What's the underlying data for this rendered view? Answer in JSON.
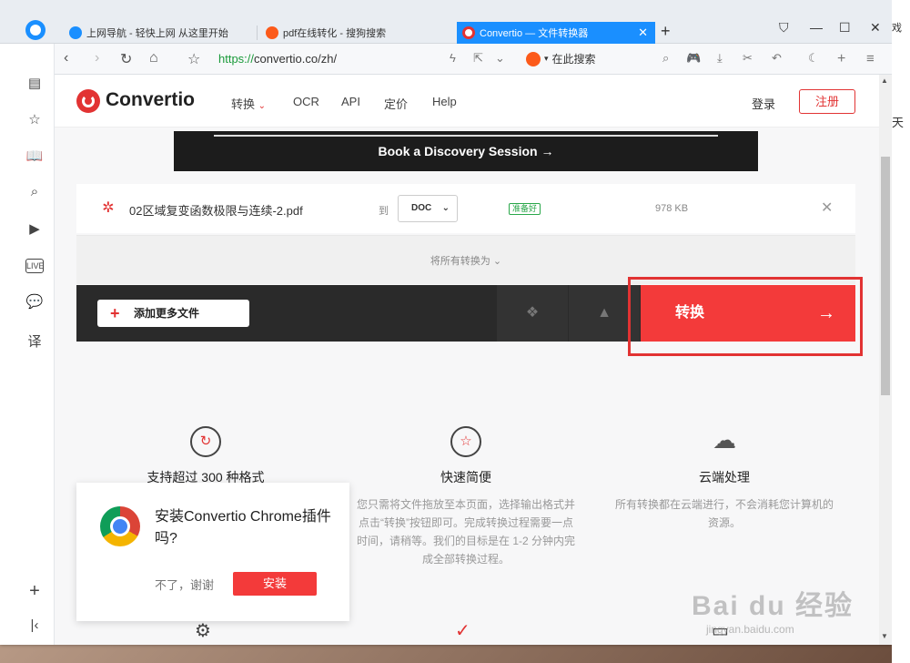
{
  "browser": {
    "tabs": [
      {
        "label": "上网导航 - 轻快上网 从这里开始",
        "favicon_color": "#1a8fff"
      },
      {
        "label": "pdf在线转化 - 搜狗搜索",
        "favicon_color": "#fc5a1a"
      },
      {
        "label": "Convertio — 文件转换器",
        "favicon_color": "#e23333",
        "active": true
      }
    ],
    "url_scheme": "https://",
    "url_rest": "convertio.co/zh/",
    "search_placeholder": "在此搜索"
  },
  "site": {
    "brand": "Convertio",
    "nav": [
      "转换",
      "OCR",
      "API",
      "定价",
      "Help"
    ],
    "login": "登录",
    "register": "注册",
    "banner": "Book a Discovery Session →"
  },
  "converter": {
    "file_name": "02区域复变函数极限与连续-2.pdf",
    "to_label": "到",
    "format": "DOC",
    "status": "准备好",
    "file_size": "978 KB",
    "convert_all": "将所有转换为",
    "add_more": "添加更多文件",
    "convert_button": "转换"
  },
  "features": [
    {
      "title": "支持超过 300 种格式",
      "desc": ""
    },
    {
      "title": "快速简便",
      "desc": "您只需将文件拖放至本页面，选择输出格式并点击“转换”按钮即可。完成转换过程需要一点时间，请稍等。我们的目标是在 1-2 分钟内完成全部转换过程。"
    },
    {
      "title": "云端处理",
      "desc": "所有转换都在云端进行，不会消耗您计算机的资源。"
    }
  ],
  "popup": {
    "text": "安装Convertio Chrome插件吗?",
    "decline": "不了，谢谢",
    "install": "安装"
  },
  "right_strip": {
    "text_top": "戏",
    "text_mid": "天"
  },
  "watermark": {
    "main": "Bai du 经验",
    "sub": "jingyan.baidu.com"
  },
  "colors": {
    "accent": "#f33a3a",
    "browser_blue": "#1a8fff",
    "url_green": "#1a9a3a"
  }
}
